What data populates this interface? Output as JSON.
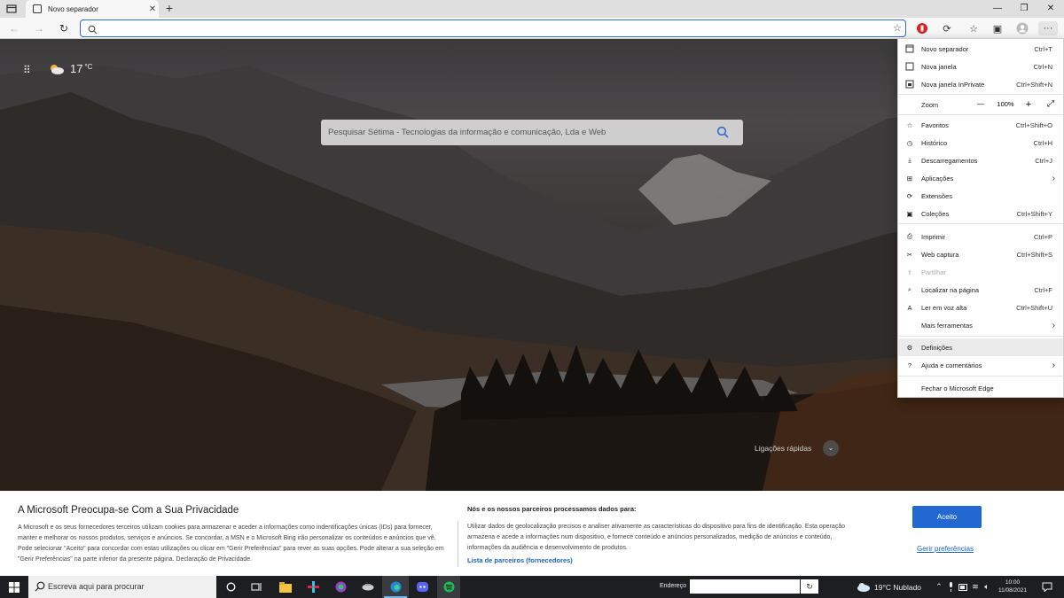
{
  "tab": {
    "title": "Novo separador",
    "close": "✕",
    "new": "+"
  },
  "window": {
    "minimize": "—",
    "maximize": "❐",
    "close": "✕"
  },
  "toolbar": {
    "back": "←",
    "forward": "→",
    "refresh": "↻",
    "address_value": ""
  },
  "newtab_page": {
    "temperature": "17",
    "temp_unit": "°C",
    "search_placeholder": "Pesquisar Sétima - Tecnologias da informação e comunicação, Lda e Web",
    "quick_links": "Ligações rápidas"
  },
  "menu": {
    "items": [
      {
        "label": "Novo separador",
        "shortcut": "Ctrl+T",
        "icon": "new-tab-icon"
      },
      {
        "label": "Nova janela",
        "shortcut": "Ctrl+N",
        "icon": "new-window-icon"
      },
      {
        "label": "Nova janela InPrivate",
        "shortcut": "Ctrl+Shift+N",
        "icon": "inprivate-icon"
      },
      {
        "label": "Zoom",
        "zoom_value": "100%",
        "minus": "—",
        "plus": "+",
        "icon": "zoom"
      },
      {
        "label": "Favoritos",
        "shortcut": "Ctrl+Shift+O",
        "icon": "favorites-icon"
      },
      {
        "label": "Histórico",
        "shortcut": "Ctrl+H",
        "icon": "history-icon"
      },
      {
        "label": "Descarregamentos",
        "shortcut": "Ctrl+J",
        "icon": "download-icon"
      },
      {
        "label": "Aplicações",
        "arrow": "›",
        "icon": "apps-icon"
      },
      {
        "label": "Extensões",
        "icon": "extensions-icon"
      },
      {
        "label": "Coleções",
        "shortcut": "Ctrl+Shift+Y",
        "icon": "collections-icon"
      },
      {
        "label": "Imprimir",
        "shortcut": "Ctrl+P",
        "icon": "print-icon"
      },
      {
        "label": "Web captura",
        "shortcut": "Ctrl+Shift+S",
        "icon": "web-capture-icon"
      },
      {
        "label": "Partilhar",
        "icon": "share-icon"
      },
      {
        "label": "Localizar na página",
        "shortcut": "Ctrl+F",
        "icon": "find-icon"
      },
      {
        "label": "Ler em voz alta",
        "shortcut": "Ctrl+Shift+U",
        "icon": "read-aloud-icon"
      },
      {
        "label": "Mais ferramentas",
        "arrow": "›",
        "icon": "more-tools-icon"
      },
      {
        "label": "Definições",
        "icon": "settings-icon"
      },
      {
        "label": "Ajuda e comentários",
        "arrow": "›",
        "icon": "help-icon"
      },
      {
        "label": "Fechar o Microsoft Edge",
        "icon": "none"
      }
    ]
  },
  "privacy": {
    "title": "A Microsoft Preocupa-se Com a Sua Privacidade",
    "text": "A Microsoft e os seus fornecedores terceiros utilizam cookies para armazenar e aceder a informações como indentificações únicas (IDs) para fornecer, manter e melhorar os nossos produtos, serviços e anúncios. Se concordar, a MSN e o Microsoft Bing irão personalizar os conteúdos e anúncios que vê. Pode selecionar \"Aceito\" para concordar com estas utilizações ou clicar em \"Gerir Preferências\" para rever as suas opções. Pode alterar a sua seleção em \"Gerir Preferências\" na parte inferior da presente página. Declaração de Privacidade.",
    "partners_title": "Nós e os nossos parceiros processamos dados para:",
    "partners_text": "Utilizar dados de geolocalização precisos e analiser ativamente as características do dispositivo para fins de identificação. Esta operação armazena e acede a informações num dispositivo, e fornece conteúdo e anúncios personalizados, medição de anúncios e conteúdo, informações da audiência e desenvolvimento de produtos.",
    "partners_link": "Lista de parceiros (fornecedores)",
    "accept": "Aceito",
    "manage": "Gerir preferências"
  },
  "taskbar": {
    "search_placeholder": "Escreva aqui para procurar",
    "address_label": "Endereço",
    "go": "↻",
    "weather": "19°C  Nublado",
    "time": "10:00",
    "date": "11/08/2021"
  },
  "colors": {
    "accent": "#2169d1",
    "link": "#1964c0",
    "taskbar": "#1d1e22"
  }
}
